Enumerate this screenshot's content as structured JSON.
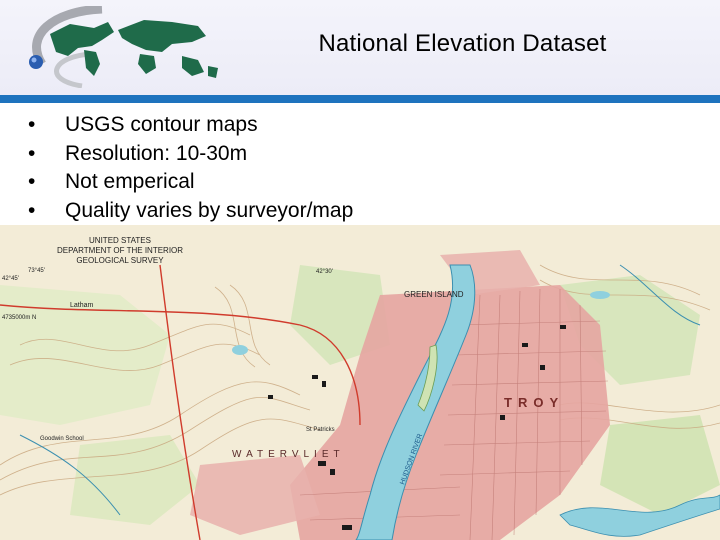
{
  "slide": {
    "title": "National Elevation Dataset",
    "bullet_glyph": "•",
    "bullets": [
      {
        "text": "USGS contour maps"
      },
      {
        "text": "Resolution: 10-30m"
      },
      {
        "text": "Not emperical"
      },
      {
        "text": "Quality varies by surveyor/map"
      }
    ]
  },
  "map": {
    "header_lines": [
      "UNITED STATES",
      "DEPARTMENT OF THE INTERIOR",
      "GEOLOGICAL SURVEY"
    ],
    "labels": {
      "green_island": "GREEN ISLAND",
      "troy": "TROY",
      "watervliet": "WATERVLIET",
      "latham": "Latham",
      "goodwin_school": "Goodwin School",
      "st_patricks": "St Patricks",
      "coord_tl": "73°45'",
      "coord_l1": "42°45'",
      "coord_l2": "4735000m N",
      "coord_top": "42°30'",
      "river": "HUDSON RIVER"
    }
  },
  "colors": {
    "accent_rule": "#1e73be",
    "map_paper": "#f3ecd7",
    "water": "#8fd0de",
    "urban": "#e5a5a1",
    "vegetation": "#cfe3b3",
    "contour": "#c9a77f"
  }
}
